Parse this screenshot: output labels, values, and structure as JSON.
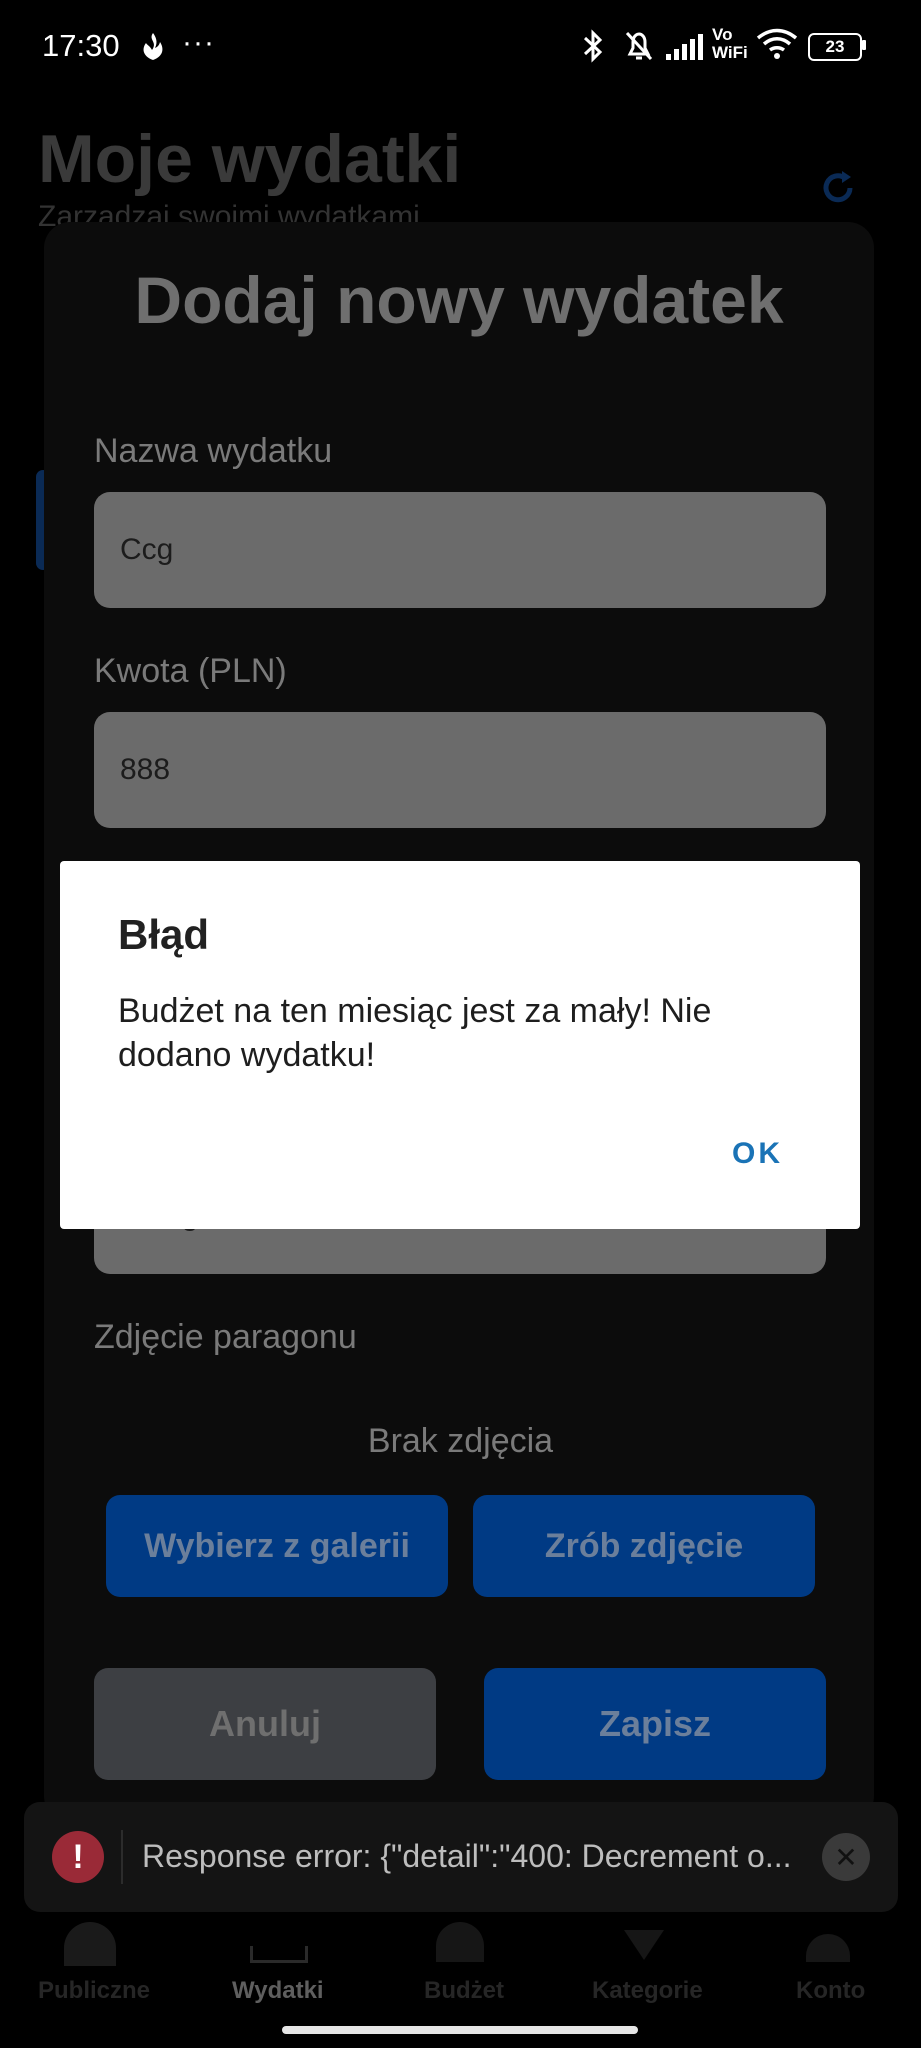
{
  "status_bar": {
    "time": "17:30",
    "vowifi_top": "Vo",
    "vowifi_bottom": "WiFi",
    "battery": "23",
    "icons": [
      "flame-icon",
      "more-icon",
      "bluetooth-icon",
      "silent-icon",
      "signal-icon",
      "wifi-icon",
      "battery-icon"
    ]
  },
  "background": {
    "title": "Moje wydatki",
    "subtitle": "Zarządzaj swoimi wydatkami"
  },
  "sheet": {
    "title": "Dodaj nowy wydatek",
    "name_label": "Nazwa wydatku",
    "name_value": "Ccg",
    "amount_label": "Kwota (PLN)",
    "amount_value": "888",
    "hidden_field_value": "String",
    "photo_label": "Zdjęcie paragonu",
    "no_photo": "Brak zdjęcia",
    "gallery_button": "Wybierz z galerii",
    "camera_button": "Zrób zdjęcie",
    "cancel_button": "Anuluj",
    "save_button": "Zapisz"
  },
  "dialog": {
    "title": "Błąd",
    "message": "Budżet na ten miesiąc jest za mały! Nie dodano wydatku!",
    "ok": "OK"
  },
  "toast": {
    "message": "Response error: {\"detail\":\"400: Decrement o..."
  },
  "nav": {
    "items": [
      "Publiczne",
      "Wydatki",
      "Budżet",
      "Kategorie",
      "Konto"
    ],
    "active": "Wydatki"
  },
  "colors": {
    "accent": "#003a84",
    "dialog_ok": "#1a73b6",
    "error": "#9a2a37"
  }
}
